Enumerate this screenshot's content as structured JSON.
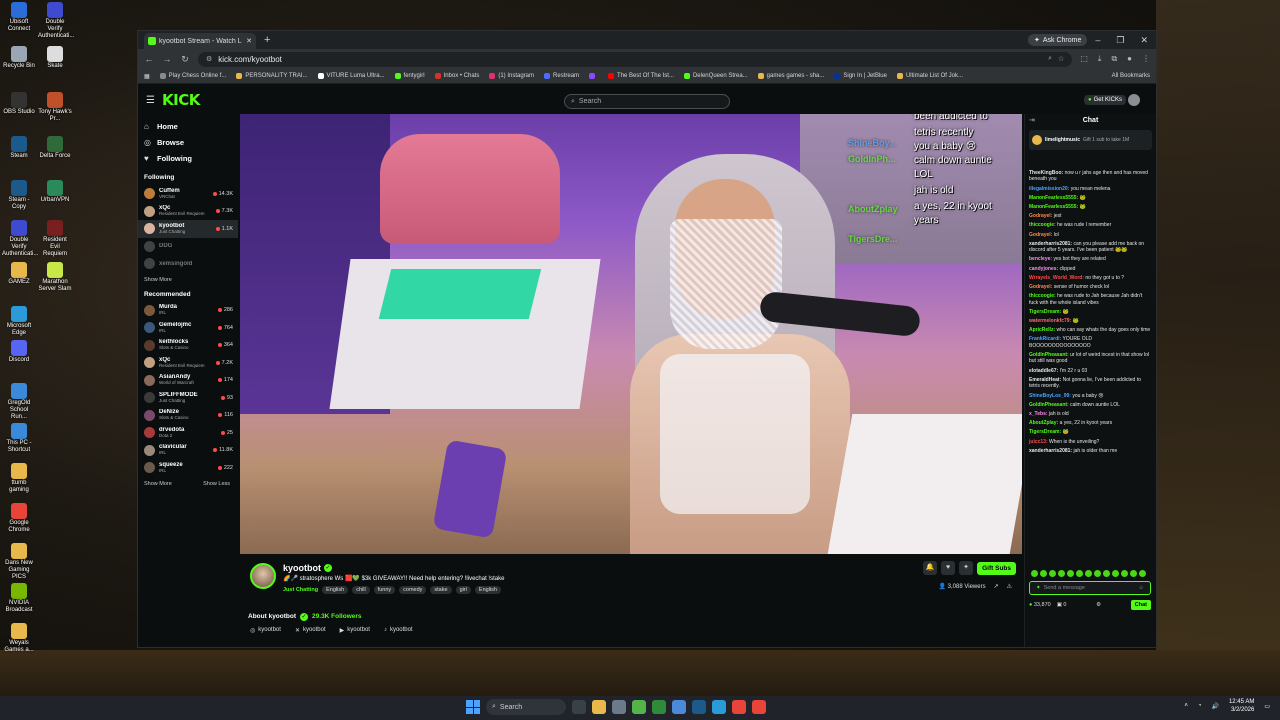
{
  "desktop": {
    "icons": [
      {
        "label": "Ubisoft Connect",
        "color": "#2a6dd9"
      },
      {
        "label": "Double Verify Authenticati...",
        "color": "#3e4ad0"
      },
      {
        "label": "Recycle Bin",
        "color": "#9aa6b3"
      },
      {
        "label": "Skate",
        "color": "#dddddd"
      },
      {
        "label": "OBS Studio",
        "color": "#333333"
      },
      {
        "label": "Tony Hawk's Pr...",
        "color": "#c0502a"
      },
      {
        "label": "Steam",
        "color": "#1b5a8a"
      },
      {
        "label": "Delta Force",
        "color": "#2f6a3a"
      },
      {
        "label": "Steam - Copy",
        "color": "#1b5a8a"
      },
      {
        "label": "UrbanVPN",
        "color": "#2b8a5a"
      },
      {
        "label": "Double Verify Authenticati...",
        "color": "#3e4ad0"
      },
      {
        "label": "Resident Evil Requiem",
        "color": "#7a1f1f"
      },
      {
        "label": "GAMEZ",
        "color": "#e8b84a"
      },
      {
        "label": "Marathon Server Slam",
        "color": "#c8e84a"
      },
      {
        "label": "Microsoft Edge",
        "color": "#2a9ad9"
      },
      {
        "label": "Discord",
        "color": "#5865f2"
      },
      {
        "label": "GregOld School Run...",
        "color": "#3a8ad9"
      },
      {
        "label": "This PC - Shortcut",
        "color": "#3a8ad9"
      },
      {
        "label": "ttumb gaming",
        "color": "#e8b84a"
      },
      {
        "label": "Google Chrome",
        "color": "#e8443a"
      },
      {
        "label": "Dans New Gaming PICS",
        "color": "#e8b84a"
      },
      {
        "label": "NVIDIA Broadcast",
        "color": "#76b900"
      },
      {
        "label": "Weyals Games a...",
        "color": "#e8b84a"
      }
    ]
  },
  "browser": {
    "tab_title": "kyootbot Stream - Watch L",
    "ask_chrome": "Ask Chrome",
    "url": "kick.com/kyootbot",
    "bookmarks": [
      {
        "label": "Play Chess Online f...",
        "color": "#8a8a8a"
      },
      {
        "label": "PERSONALITY TRAI...",
        "color": "#e8b84a"
      },
      {
        "label": "VITURE Luma Ultra...",
        "color": "#ffffff"
      },
      {
        "label": "fentygirl",
        "color": "#53fc18"
      },
      {
        "label": "Inbox • Chats",
        "color": "#d93025"
      },
      {
        "label": "(1) Instagram",
        "color": "#e1306c"
      },
      {
        "label": "Restream",
        "color": "#4a6dff"
      },
      {
        "label": "",
        "color": "#9146ff"
      },
      {
        "label": "The Best Of The Ist...",
        "color": "#ff0000"
      },
      {
        "label": "DelenQueen Strea...",
        "color": "#53fc18"
      },
      {
        "label": "games games - sha...",
        "color": "#e8b84a"
      },
      {
        "label": "Sign In | JetBlue",
        "color": "#0033a0"
      },
      {
        "label": "Ultimate List Of Jok...",
        "color": "#e8b84a"
      }
    ],
    "all_bookmarks": "All Bookmarks"
  },
  "kick": {
    "logo": "KICK",
    "search_placeholder": "Search",
    "get_kicks": "Get KICKs",
    "nav": [
      {
        "label": "Home",
        "icon": "home-icon"
      },
      {
        "label": "Browse",
        "icon": "compass-icon"
      },
      {
        "label": "Following",
        "icon": "heart-icon"
      }
    ],
    "following_title": "Following",
    "following": [
      {
        "name": "Cuffem",
        "cat": "VRChat",
        "viewers": "14.3K",
        "color": "#c07a3a"
      },
      {
        "name": "xQc",
        "cat": "Resident Evil Requiem",
        "viewers": "7.3K",
        "color": "#c0a080"
      },
      {
        "name": "kyootbot",
        "cat": "Just Chatting",
        "viewers": "1.1K",
        "color": "#d9b4a0"
      },
      {
        "name": "DDG",
        "cat": "",
        "viewers": "",
        "color": "#777777"
      },
      {
        "name": "xemsingold",
        "cat": "",
        "viewers": "",
        "color": "#777777"
      }
    ],
    "show_more": "Show More",
    "recommended_title": "Recommended",
    "recommended": [
      {
        "name": "Murda",
        "cat": "IRL",
        "viewers": "286",
        "color": "#7a5a3a"
      },
      {
        "name": "Gemelojmc",
        "cat": "IRL",
        "viewers": "764",
        "color": "#3a5a7a"
      },
      {
        "name": "keithlocks",
        "cat": "Slots & Casino",
        "viewers": "364",
        "color": "#5a3a2a"
      },
      {
        "name": "xQc",
        "cat": "Resident Evil Requiem",
        "viewers": "7.2K",
        "color": "#c0a080"
      },
      {
        "name": "AsianAndy",
        "cat": "World of Warcraft",
        "viewers": "174",
        "color": "#8a6a5a"
      },
      {
        "name": "SPLIFFMODE",
        "cat": "Just Chatting",
        "viewers": "93",
        "color": "#3a3a3a"
      },
      {
        "name": "DeNize",
        "cat": "Slots & Casino",
        "viewers": "116",
        "color": "#7a4a6a"
      },
      {
        "name": "drvedota",
        "cat": "Dota 2",
        "viewers": "25",
        "color": "#aa3a3a"
      },
      {
        "name": "clavicular",
        "cat": "IRL",
        "viewers": "11.8K",
        "color": "#9a8a7a"
      },
      {
        "name": "squeeze",
        "cat": "IRL",
        "viewers": "222",
        "color": "#6a5a4a"
      }
    ],
    "show_more_2": "Show More",
    "show_less": "Show Less",
    "overlay": {
      "lines": [
        "been addicted to",
        "tetris recently",
        "you a baby 😢",
        "calm down auntie",
        "LOL",
        "jah is old",
        "a yes, 22 in kyoot",
        "years"
      ],
      "names": [
        "ShineBoy...",
        "GoldlnPh...",
        "AboutZplay",
        "TigersDre..."
      ]
    },
    "streamer": {
      "name": "kyootbot",
      "title": "🌈🎤 stratosphere Ws 🟥💚 $3k GIVEAWAY!! Need help entering? !livechat !stake",
      "category": "Just Chatting",
      "tags": [
        "English",
        "chill",
        "funny",
        "comedy",
        "stake",
        "girl",
        "English"
      ],
      "gift_subs": "Gift Subs",
      "viewers": "3,088 Viewers",
      "about": "About kyootbot",
      "followers": "29.3K Followers",
      "socials": [
        {
          "label": "kyootbot",
          "icon": "instagram-icon",
          "glyph": "◎"
        },
        {
          "label": "kyootbot",
          "icon": "x-icon",
          "glyph": "✕"
        },
        {
          "label": "kyootbot",
          "icon": "youtube-icon",
          "glyph": "▶"
        },
        {
          "label": "kyootbot",
          "icon": "tiktok-icon",
          "glyph": "♪"
        }
      ]
    },
    "chat": {
      "title": "Chat",
      "pinned_user": "limelightmusic",
      "pinned_text": "Gift 1 sub to take 1M",
      "messages": [
        {
          "u": "TheeKingBoo:",
          "t": "now u r jahs age then and has moved beneath you",
          "c": "#e6e6e6"
        },
        {
          "u": "illegalmission20:",
          "t": "you mean melena",
          "c": "#4aa3ff"
        },
        {
          "u": "ManonFearless5555:",
          "t": "🐸",
          "c": "#53fc18"
        },
        {
          "u": "ManonFearless5555:",
          "t": "🐸",
          "c": "#53fc18"
        },
        {
          "u": "Godrayel:",
          "t": "jest",
          "c": "#ff8a4a"
        },
        {
          "u": "thiccoogie:",
          "t": "he was rude I remember",
          "c": "#53fc18"
        },
        {
          "u": "Godrayel:",
          "t": "lol",
          "c": "#ff8a4a"
        },
        {
          "u": "xanderharris2081:",
          "t": "can you please add me back on discord after 5 years. I've been patient 🐸🐸",
          "c": "#e6e6e6"
        },
        {
          "u": "bencleye:",
          "t": "yes bot they are related",
          "c": "#ff8af0"
        },
        {
          "u": "candyjones:",
          "t": "clipped",
          "c": "#ff8af0"
        },
        {
          "u": "Wrrayels_World_Word:",
          "t": "no they got u to ?",
          "c": "#ff4a4a"
        },
        {
          "u": "Godrayel:",
          "t": "sense of humor check lol",
          "c": "#ff8a4a"
        },
        {
          "u": "thiccoogie:",
          "t": "he was rude to Jah because Jah didn't fuck with the whole island vibes",
          "c": "#53fc18"
        },
        {
          "u": "TigersDream:",
          "t": "🐸",
          "c": "#53fc18"
        },
        {
          "u": "watermelonkfc79:",
          "t": "🐸",
          "c": "#ff6b6b"
        },
        {
          "u": "ApricRellz:",
          "t": "who can say whats the day goes only time",
          "c": "#53fc18"
        },
        {
          "u": "FrankRicardi:",
          "t": "YOURE OLD BOOOOOOOOOOOOOOO",
          "c": "#4aa3ff"
        },
        {
          "u": "GoldInPheasant:",
          "t": "ur lot of weird incest in that show lol but still was good",
          "c": "#53fc18"
        },
        {
          "u": "elotaddle67:",
          "t": "I'm 22 r u 03",
          "c": "#e6e6e6"
        },
        {
          "u": "EmeraldHeat:",
          "t": "Not gonna lie, I've been addicted to tetris recently.",
          "c": "#e6e6e6"
        },
        {
          "u": "ShineBoyLos_99:",
          "t": "you a baby 😢",
          "c": "#4aa3ff"
        },
        {
          "u": "GoldInPheasant:",
          "t": "calm down auntie LOL",
          "c": "#53fc18"
        },
        {
          "u": "x_Tebs:",
          "t": "jah is old",
          "c": "#ff8af0"
        },
        {
          "u": "AboutZplay:",
          "t": "a yes, 22 in kyoot years",
          "c": "#53fc18"
        },
        {
          "u": "TigersDream:",
          "t": "🐸",
          "c": "#53fc18"
        },
        {
          "u": "juicc13:",
          "t": "When is the unveiling?",
          "c": "#ff4a4a"
        },
        {
          "u": "xanderharris2081:",
          "t": "jah is older than me",
          "c": "#e6e6e6"
        }
      ],
      "input_placeholder": "Send a message",
      "kicks_balance": "33,870",
      "other_count": "0",
      "send": "Chat"
    }
  },
  "taskbar": {
    "search": "Search",
    "time": "12:45 AM",
    "date": "3/2/2026"
  }
}
